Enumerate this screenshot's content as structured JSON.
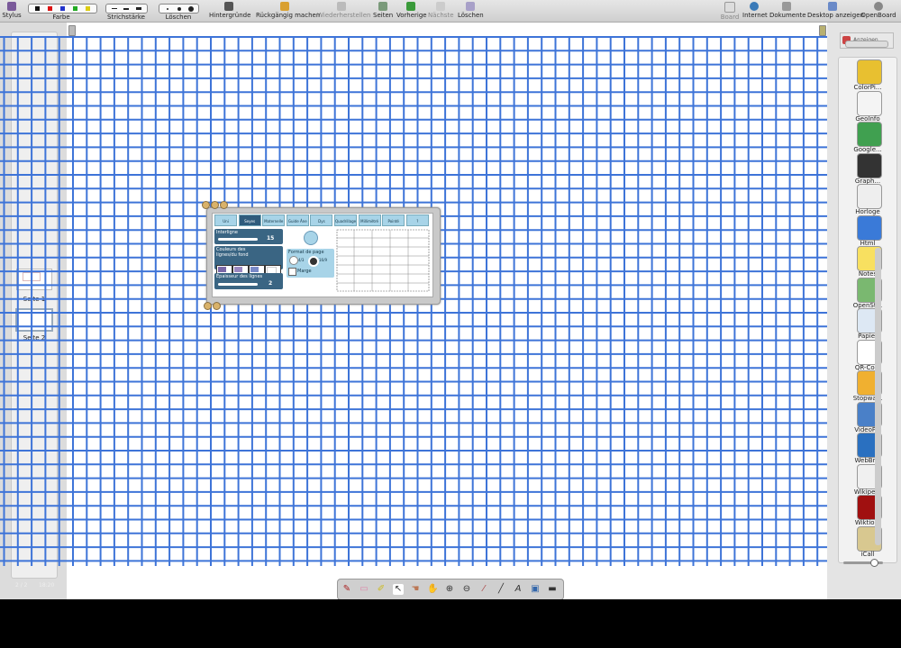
{
  "toolbar": {
    "stylus": "Stylus",
    "color": "Farbe",
    "stroke": "Strichstärke",
    "erase": "Löschen",
    "backgrounds": "Hintergründe",
    "undo": "Rückgängig machen",
    "redo": "Wiederherstellen",
    "pages": "Seiten",
    "previous": "Vorherige",
    "next": "Nächste",
    "clear": "Löschen",
    "board": "Board",
    "internet": "Internet",
    "documents": "Dokumente",
    "desktop": "Desktop anzeigen",
    "openboard": "OpenBoard"
  },
  "colors": {
    "black": "#111111",
    "red": "#dd1111",
    "blue": "#2233cc",
    "green": "#22aa22",
    "yellow": "#ddcc11",
    "grid": "#3e74d8"
  },
  "pages": {
    "items": [
      {
        "label": "Seite 1"
      },
      {
        "label": "Seite 2"
      }
    ],
    "counter": "2 / 2",
    "time": "18:20"
  },
  "widget": {
    "tabs": [
      "Uni",
      "Seyes",
      "Maternelle",
      "Guide Âne",
      "Dys",
      "Quadrillage",
      "Millimètré",
      "Pointé",
      "?"
    ],
    "active_tab": "Seyes",
    "interline_label": "Interligne",
    "interline_value": "15",
    "colors_label": "Couleurs des lignes/du fond",
    "thickness_label": "Épaisseur des lignes",
    "thickness_value": "2",
    "format_label": "Format de page",
    "format_4_3": "4/3",
    "format_16_9": "16/9",
    "margin_label": "Marge"
  },
  "library": {
    "apps": [
      "ColorPi...",
      "GeoInfo",
      "Google...",
      "Graph...",
      "Horloge",
      "Html",
      "Notes",
      "OpenSt...",
      "Papier",
      "QR-Co...",
      "Stopwa...",
      "VideoP...",
      "WebBr...",
      "Wikipe...",
      "Wiktio...",
      "iCall"
    ],
    "top_label": "Anzeigen"
  }
}
